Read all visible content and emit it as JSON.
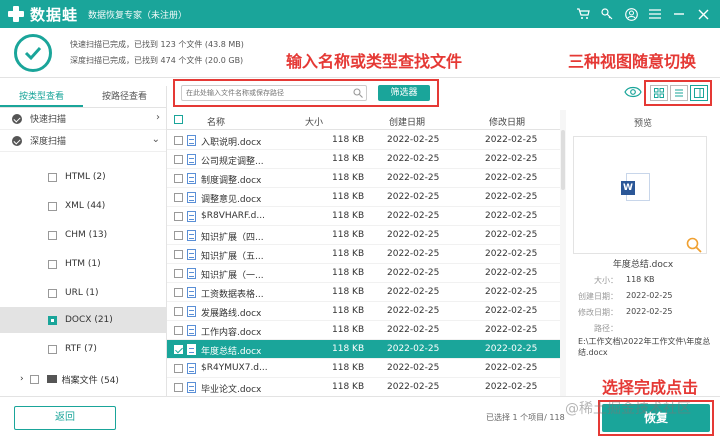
{
  "titlebar": {
    "app_name": "数据蛙",
    "subtitle": "数据恢复专家（未注册）",
    "icons": [
      "cart-icon",
      "key-icon",
      "user-icon",
      "menu-icon",
      "minimize-icon",
      "close-icon"
    ]
  },
  "header": {
    "quick_scan": "快速扫描已完成，已找到 123 个文件 (43.8 MB)",
    "deep_scan": "深度扫描已完成，已找到 474 个文件 (20.0 GB)"
  },
  "annotations": {
    "search": "输入名称或类型查找文件",
    "views": "三种视图随意切换",
    "finish": "选择完成点击"
  },
  "sidebar": {
    "tabs": [
      "按类型查看",
      "按路径查看"
    ],
    "quick_scan": "快速扫描",
    "deep_scan": "深度扫描",
    "types": [
      {
        "label": "HTML (2)"
      },
      {
        "label": "XML (44)"
      },
      {
        "label": "CHM (13)"
      },
      {
        "label": "HTM (1)"
      },
      {
        "label": "URL (1)"
      },
      {
        "label": "DOCX (21)"
      },
      {
        "label": "RTF (7)"
      }
    ],
    "archive": "档案文件 (54)"
  },
  "search": {
    "placeholder": "在此处输入文件名称或保存路径",
    "filter_label": "筛选器"
  },
  "table": {
    "headers": {
      "name": "名称",
      "size": "大小",
      "created": "创建日期",
      "modified": "修改日期"
    },
    "rows": [
      {
        "name": "入职说明.docx",
        "size": "118 KB",
        "created": "2022-02-25",
        "modified": "2022-02-25"
      },
      {
        "name": "公司规定调整...",
        "size": "118 KB",
        "created": "2022-02-25",
        "modified": "2022-02-25"
      },
      {
        "name": "制度调整.docx",
        "size": "118 KB",
        "created": "2022-02-25",
        "modified": "2022-02-25"
      },
      {
        "name": "调整意见.docx",
        "size": "118 KB",
        "created": "2022-02-25",
        "modified": "2022-02-25"
      },
      {
        "name": "$R8VHARF.d...",
        "size": "118 KB",
        "created": "2022-02-25",
        "modified": "2022-02-25"
      },
      {
        "name": "知识扩展（四...",
        "size": "118 KB",
        "created": "2022-02-25",
        "modified": "2022-02-25"
      },
      {
        "name": "知识扩展（五...",
        "size": "118 KB",
        "created": "2022-02-25",
        "modified": "2022-02-25"
      },
      {
        "name": "知识扩展（一...",
        "size": "118 KB",
        "created": "2022-02-25",
        "modified": "2022-02-25"
      },
      {
        "name": "工资数据表格...",
        "size": "118 KB",
        "created": "2022-02-25",
        "modified": "2022-02-25"
      },
      {
        "name": "发展路线.docx",
        "size": "118 KB",
        "created": "2022-02-25",
        "modified": "2022-02-25"
      },
      {
        "name": "工作内容.docx",
        "size": "118 KB",
        "created": "2022-02-25",
        "modified": "2022-02-25"
      },
      {
        "name": "年度总结.docx",
        "size": "118 KB",
        "created": "2022-02-25",
        "modified": "2022-02-25"
      },
      {
        "name": "$R4YMUX7.d...",
        "size": "118 KB",
        "created": "2022-02-25",
        "modified": "2022-02-25"
      },
      {
        "name": "毕业论文.docx",
        "size": "118 KB",
        "created": "2022-02-25",
        "modified": "2022-02-25"
      }
    ]
  },
  "preview": {
    "title": "预览",
    "file_name": "年度总结.docx",
    "size_label": "大小：",
    "size": "118 KB",
    "created_label": "创建日期：",
    "created": "2022-02-25",
    "modified_label": "修改日期：",
    "modified": "2022-02-25",
    "path_label": "路径：",
    "path": "E:\\工作文档\\2022年工作文件\\年度总结.docx"
  },
  "footer": {
    "back_label": "返回",
    "selected_info": "已选择 1 个项目/ 118",
    "recover_label": "恢复",
    "watermark": "@稀土掘金技术社区"
  },
  "colors": {
    "accent": "#1aa59a",
    "annotation": "#e53935"
  }
}
